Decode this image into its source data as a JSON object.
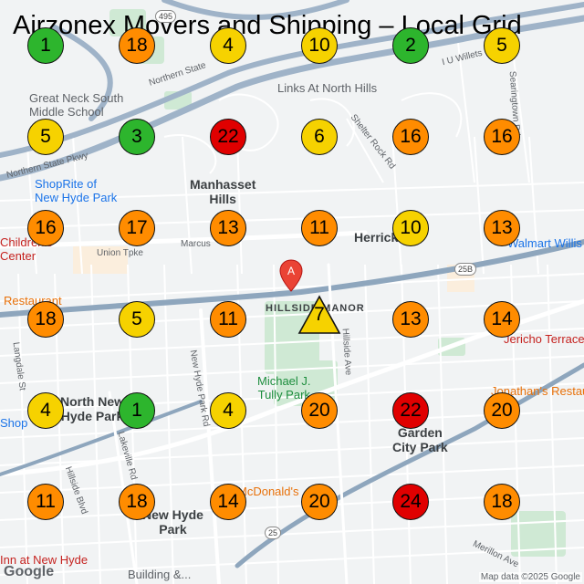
{
  "title": "Airzonex Movers and Shipping – Local Grid",
  "colors": {
    "green": "#2db52d",
    "yellow": "#f6d200",
    "orange": "#ff8c00",
    "red": "#e00000"
  },
  "places": {
    "great_neck_south": "Great Neck South\nMiddle School",
    "links": "Links At North Hills",
    "shoprite": "ShopRite of\nNew Hyde Park",
    "manhasset_hills": "Manhasset\nHills",
    "herricks": "Herricks",
    "childrens": "Children's\nCenter",
    "walmart": "Walmart Willis",
    "restaurant": "Restaurant",
    "hillside_manor": "HILLSIDE MANOR",
    "jericho": "Jericho Terrace",
    "north_new_hyde_park": "North New\nHyde Park",
    "shop": "Shop",
    "tully_park": "Michael J.\nTully Park",
    "jonathans": "Jonathan's Restau",
    "garden_city_park": "Garden\nCity Park",
    "mcdonalds": "McDonald's",
    "new_hyde_park": "New Hyde\nPark",
    "inn": "Inn at New Hyde",
    "building": "Building &..."
  },
  "roads": {
    "northern_state": "Northern State Pkwy",
    "northern_state_2": "Northern State",
    "shelter_rock": "Shelter Rock Rd",
    "union_tpke": "Union Tpke",
    "marcus": "Marcus",
    "new_hyde_park_rd": "New Hyde Park Rd",
    "lakeville": "Lakeville Rd",
    "hillside_blvd": "Hillside Blvd",
    "langdale": "Langdale St",
    "merillon": "Merillon Ave",
    "willets": "I U Willets",
    "searingtown": "Searingtown Rd",
    "hillside_ave": "Hillside Ave"
  },
  "shields": {
    "i495": "495",
    "r25b": "25B",
    "r25": "25"
  },
  "pin_label": "A",
  "credit": "Map data ©2025 Google",
  "google_logo": "Google",
  "grid": [
    {
      "rank": "1",
      "level": "green"
    },
    {
      "rank": "18",
      "level": "orange"
    },
    {
      "rank": "4",
      "level": "yellow"
    },
    {
      "rank": "10",
      "level": "yellow"
    },
    {
      "rank": "2",
      "level": "green"
    },
    {
      "rank": "5",
      "level": "yellow"
    },
    {
      "rank": "5",
      "level": "yellow"
    },
    {
      "rank": "3",
      "level": "green"
    },
    {
      "rank": "22",
      "level": "red"
    },
    {
      "rank": "6",
      "level": "yellow"
    },
    {
      "rank": "16",
      "level": "orange"
    },
    {
      "rank": "16",
      "level": "orange"
    },
    {
      "rank": "16",
      "level": "orange"
    },
    {
      "rank": "17",
      "level": "orange"
    },
    {
      "rank": "13",
      "level": "orange"
    },
    {
      "rank": "11",
      "level": "orange"
    },
    {
      "rank": "10",
      "level": "yellow"
    },
    {
      "rank": "13",
      "level": "orange"
    },
    {
      "rank": "18",
      "level": "orange"
    },
    {
      "rank": "5",
      "level": "yellow"
    },
    {
      "rank": "11",
      "level": "orange"
    },
    {
      "rank": "7",
      "level": "yellow",
      "center": true
    },
    {
      "rank": "13",
      "level": "orange"
    },
    {
      "rank": "14",
      "level": "orange"
    },
    {
      "rank": "4",
      "level": "yellow"
    },
    {
      "rank": "1",
      "level": "green"
    },
    {
      "rank": "4",
      "level": "yellow"
    },
    {
      "rank": "20",
      "level": "orange"
    },
    {
      "rank": "22",
      "level": "red"
    },
    {
      "rank": "20",
      "level": "orange"
    },
    {
      "rank": "11",
      "level": "orange"
    },
    {
      "rank": "18",
      "level": "orange"
    },
    {
      "rank": "14",
      "level": "orange"
    },
    {
      "rank": "20",
      "level": "orange"
    },
    {
      "rank": "24",
      "level": "red"
    },
    {
      "rank": "18",
      "level": "orange"
    }
  ]
}
